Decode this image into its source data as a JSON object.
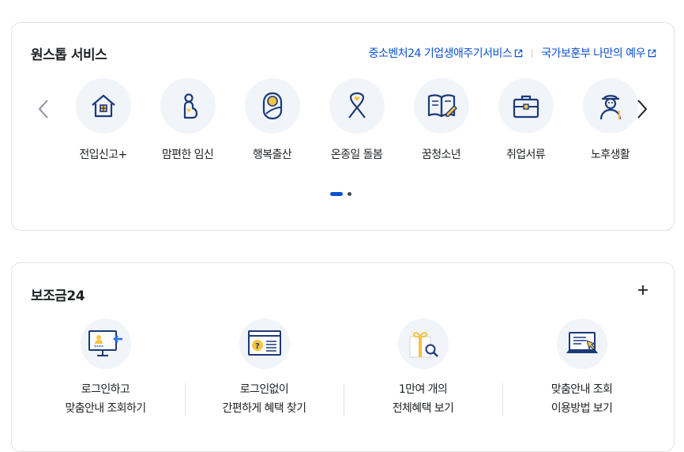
{
  "onestop": {
    "title": "원스톱 서비스",
    "links": [
      "중소벤처24 기업생애주기서비스",
      "국가보훈부 나만의 예우"
    ],
    "services": [
      {
        "label": "전입신고+",
        "icon": "house-icon"
      },
      {
        "label": "맘편한 임신",
        "icon": "pregnant-icon"
      },
      {
        "label": "행복출산",
        "icon": "newborn-icon"
      },
      {
        "label": "온종일 돌봄",
        "icon": "ribbon-icon"
      },
      {
        "label": "꿈청소년",
        "icon": "book-icon"
      },
      {
        "label": "취업서류",
        "icon": "briefcase-icon"
      },
      {
        "label": "노후생활",
        "icon": "elder-icon"
      }
    ]
  },
  "subsidy": {
    "title": "보조금24",
    "items": [
      {
        "line1": "로그인하고",
        "line2": "맞춤안내 조회하기",
        "icon": "login-monitor-icon"
      },
      {
        "line1": "로그인없이",
        "line2": "간편하게 혜택 찾기",
        "icon": "question-doc-icon"
      },
      {
        "line1": "1만여 개의",
        "line2": "전체혜택 보기",
        "icon": "gift-search-icon"
      },
      {
        "line1": "맞춤안내 조회",
        "line2": "이용방법 보기",
        "icon": "laptop-guide-icon"
      }
    ]
  },
  "colors": {
    "accent": "#0b50d0",
    "icon_navy": "#1c3a78",
    "icon_yellow": "#f6c443"
  }
}
